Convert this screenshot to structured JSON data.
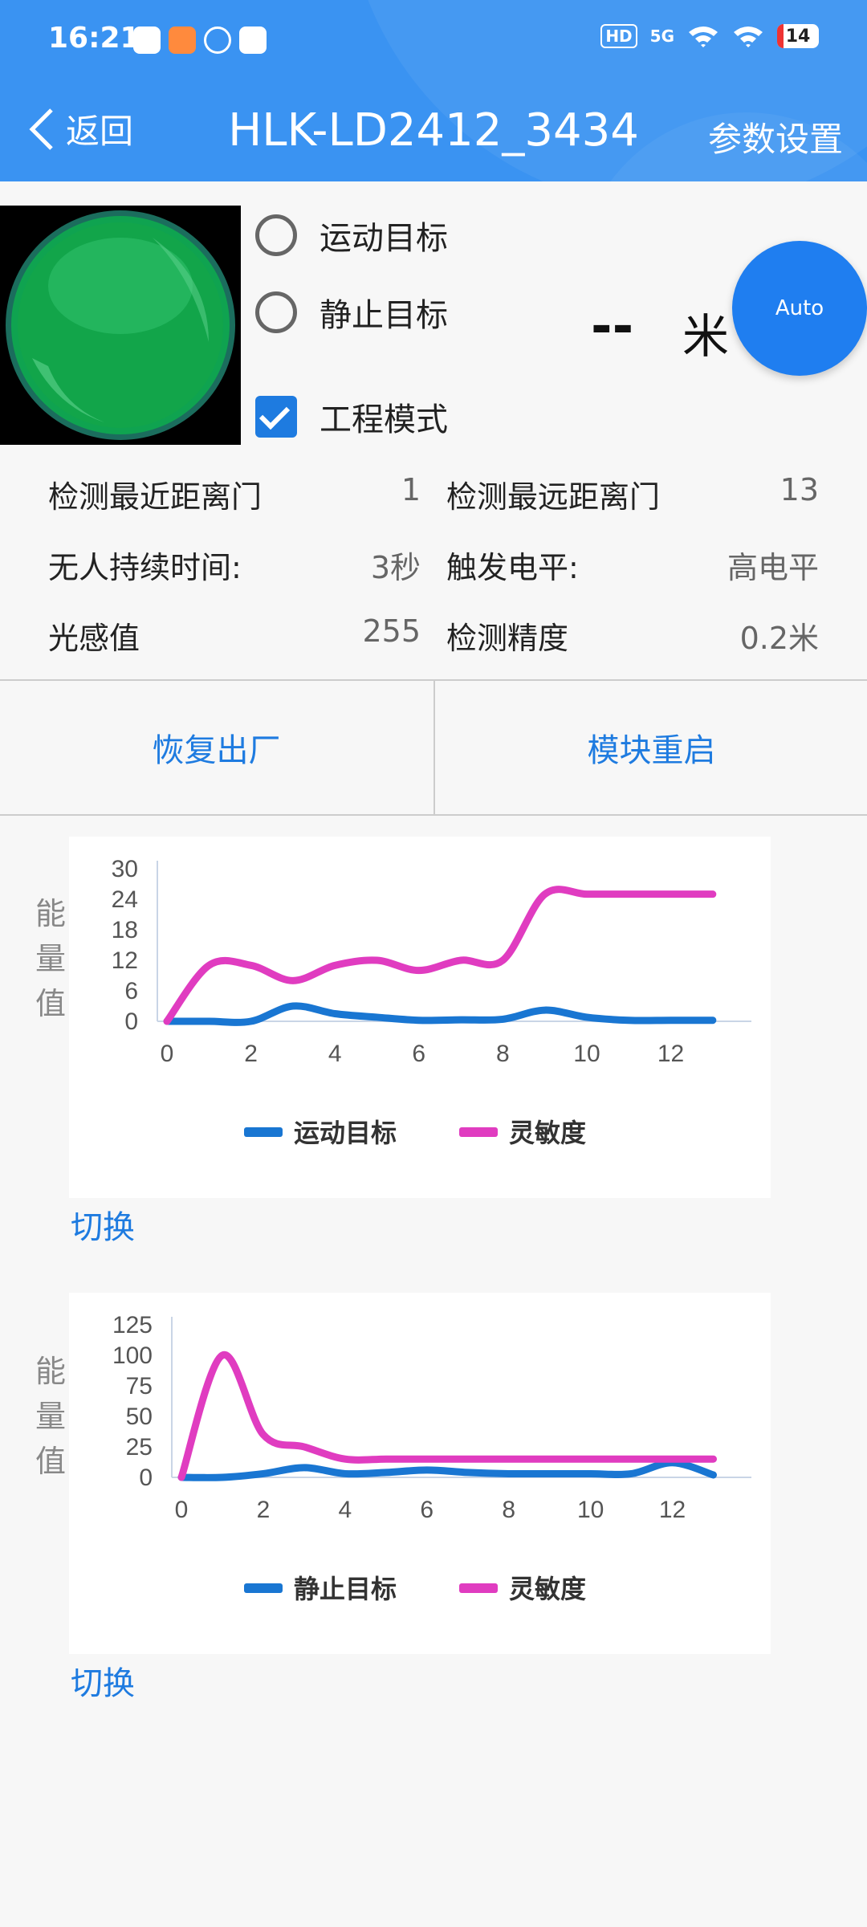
{
  "status_bar": {
    "time": "16:21",
    "hd": "HD",
    "network": "5G",
    "battery": "14",
    "icons": [
      "app-icon-1",
      "app-icon-2",
      "app-icon-3",
      "vivo-icon",
      "signal-icon",
      "wifi-icon"
    ]
  },
  "nav": {
    "back_label": "返回",
    "title": "HLK-LD2412_3434",
    "settings_label": "参数设置"
  },
  "options": {
    "moving_target": "运动目标",
    "static_target": "静止目标",
    "engineering_mode": "工程模式",
    "engineering_mode_checked": true
  },
  "distance": {
    "value": "--",
    "unit": "米"
  },
  "fab_label": "Auto",
  "params": [
    {
      "label": "检测最近距离门",
      "value": "1"
    },
    {
      "label": "检测最远距离门",
      "value": "13"
    },
    {
      "label": "无人持续时间:",
      "value": "3秒"
    },
    {
      "label": "触发电平:",
      "value": "高电平"
    },
    {
      "label": "光感值",
      "value": "255"
    },
    {
      "label": "检测精度",
      "value": "0.2米"
    }
  ],
  "buttons": {
    "factory_reset": "恢复出厂",
    "restart": "模块重启"
  },
  "chart_ylabel": "能 量 值",
  "switch_label": "切换",
  "colors": {
    "accent": "#1e7be0",
    "header": "#3a93f2",
    "series_blue": "#1976d2",
    "series_pink": "#e03cc0"
  },
  "chart_data": [
    {
      "type": "line",
      "ylabel": "能量值",
      "x": [
        0,
        1,
        2,
        3,
        4,
        5,
        6,
        7,
        8,
        9,
        10,
        11,
        12,
        13
      ],
      "xticks": [
        "0",
        "2",
        "4",
        "6",
        "8",
        "10",
        "12"
      ],
      "yticks": [
        "0",
        "6",
        "12",
        "18",
        "24",
        "30"
      ],
      "ylim": [
        0,
        30
      ],
      "series": [
        {
          "name": "运动目标",
          "color": "#1976d2",
          "values": [
            0,
            0,
            0,
            3,
            1.5,
            0.8,
            0.2,
            0.3,
            0.4,
            2.2,
            0.8,
            0.2,
            0.2,
            0.2
          ]
        },
        {
          "name": "灵敏度",
          "color": "#e03cc0",
          "values": [
            0,
            11,
            11,
            8,
            11,
            12,
            10,
            12,
            12,
            25,
            25,
            25,
            25,
            25
          ]
        }
      ]
    },
    {
      "type": "line",
      "ylabel": "能量值",
      "x": [
        0,
        1,
        2,
        3,
        4,
        5,
        6,
        7,
        8,
        9,
        10,
        11,
        12,
        13
      ],
      "xticks": [
        "0",
        "2",
        "4",
        "6",
        "8",
        "10",
        "12"
      ],
      "yticks": [
        "0",
        "25",
        "50",
        "75",
        "100",
        "125"
      ],
      "ylim": [
        0,
        125
      ],
      "series": [
        {
          "name": "静止目标",
          "color": "#1976d2",
          "values": [
            0,
            0,
            3,
            8,
            3,
            4,
            6,
            4,
            3,
            3,
            3,
            3,
            12,
            2
          ]
        },
        {
          "name": "灵敏度",
          "color": "#e03cc0",
          "values": [
            0,
            100,
            35,
            25,
            15,
            15,
            15,
            15,
            15,
            15,
            15,
            15,
            15,
            15
          ]
        }
      ]
    }
  ]
}
